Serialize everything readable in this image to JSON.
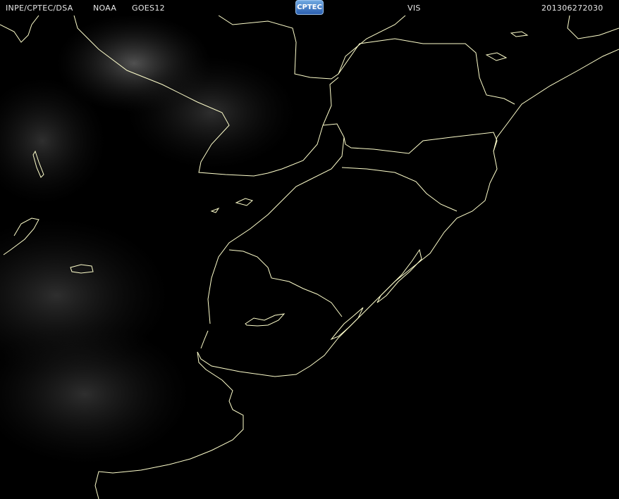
{
  "header": {
    "agency": "INPE/CPTEC/DSA",
    "source": "NOAA",
    "satellite": "GOES12",
    "channel": "VIS",
    "timestamp": "201306272030"
  },
  "logo": {
    "text": "CPTEC"
  },
  "colors": {
    "background": "#000000",
    "coastline": "#ffffcc",
    "header_text": "#e8e8e8",
    "logo": "#3a78c8"
  }
}
